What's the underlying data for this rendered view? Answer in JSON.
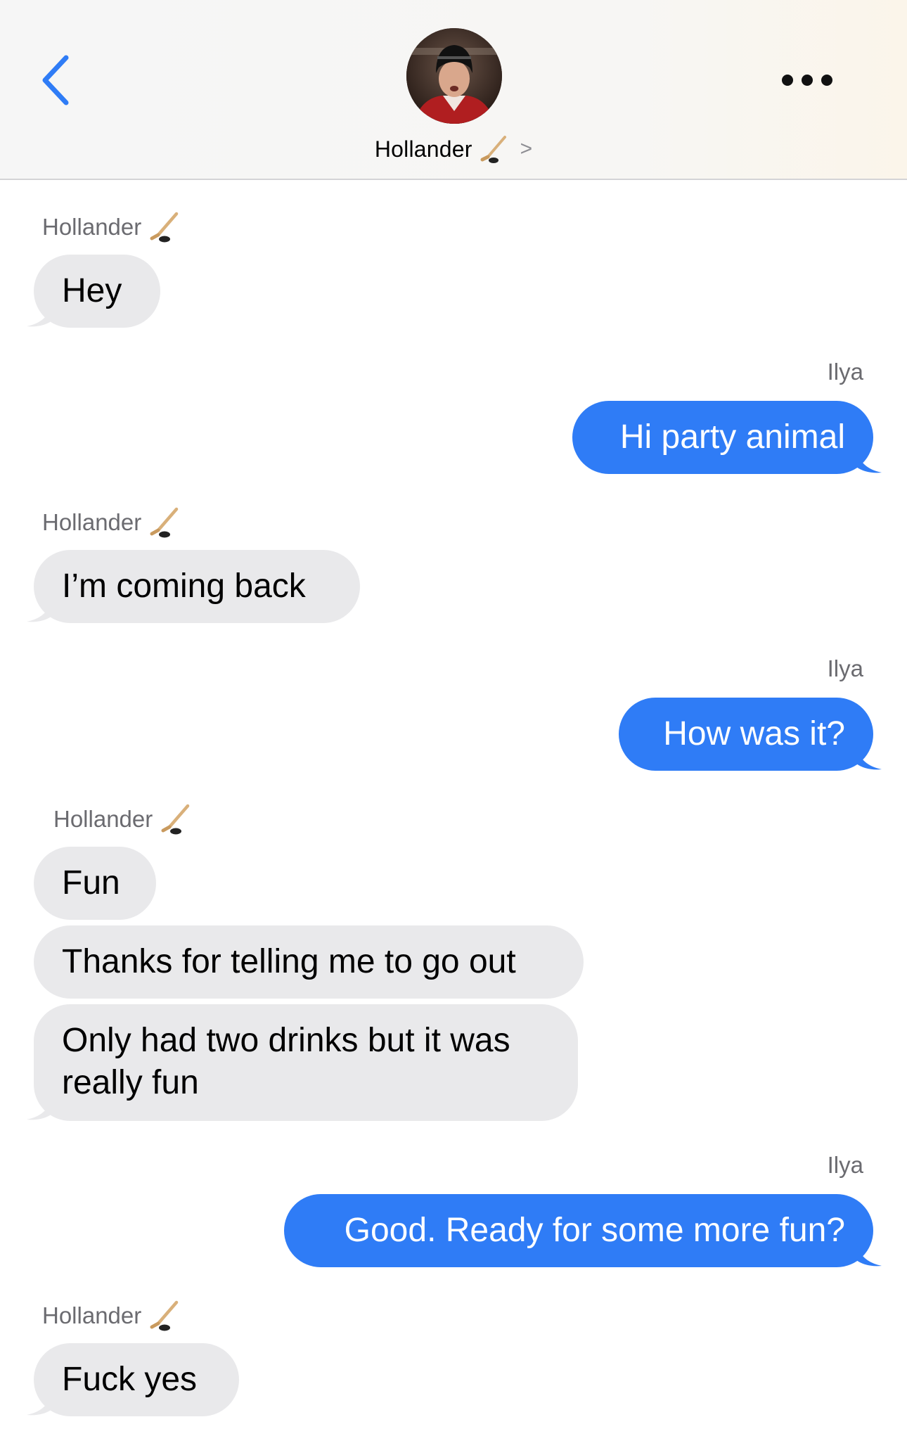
{
  "header": {
    "contact_name": "Hollander",
    "contact_emoji_icon": "hockey-stick-icon",
    "back_icon": "chevron-left-icon",
    "more_icon": "ellipsis-icon",
    "disclosure": ">"
  },
  "colors": {
    "outgoing_bubble": "#2f7cf6",
    "incoming_bubble": "#e9e9eb",
    "accent": "#2f7cf6"
  },
  "messages": [
    {
      "sender": "Hollander",
      "direction": "in",
      "texts": [
        "Hey"
      ]
    },
    {
      "sender": "Ilya",
      "direction": "out",
      "texts": [
        "Hi party animal"
      ]
    },
    {
      "sender": "Hollander",
      "direction": "in",
      "texts": [
        "I’m coming back"
      ]
    },
    {
      "sender": "Ilya",
      "direction": "out",
      "texts": [
        "How was it?"
      ]
    },
    {
      "sender": "Hollander",
      "direction": "in",
      "texts": [
        "Fun",
        "Thanks for telling me to go out",
        "Only had two drinks but it was really fun"
      ]
    },
    {
      "sender": "Ilya",
      "direction": "out",
      "texts": [
        "Good. Ready for some more fun?"
      ]
    },
    {
      "sender": "Hollander",
      "direction": "in",
      "texts": [
        "Fuck yes"
      ]
    }
  ]
}
